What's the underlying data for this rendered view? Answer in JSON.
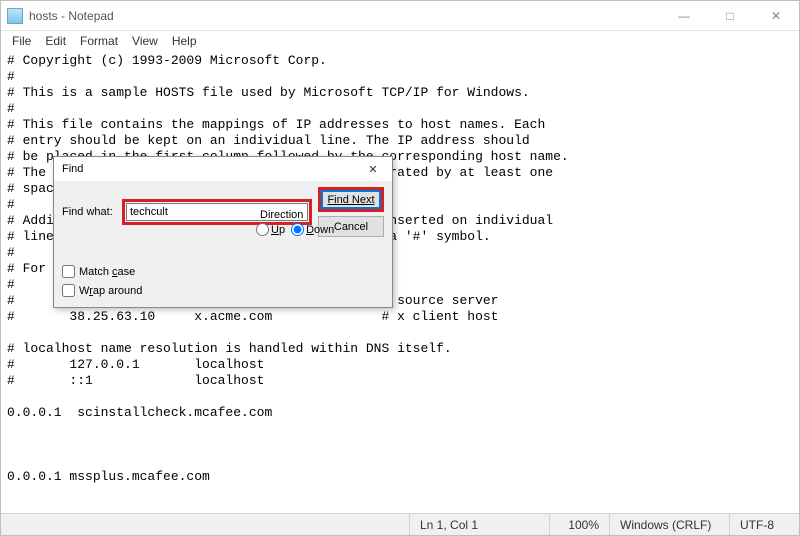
{
  "window": {
    "title": "hosts - Notepad",
    "minimize": "—",
    "maximize": "□",
    "close": "✕"
  },
  "menu": {
    "file": "File",
    "edit": "Edit",
    "format": "Format",
    "view": "View",
    "help": "Help"
  },
  "document_text": "# Copyright (c) 1993-2009 Microsoft Corp.\n#\n# This is a sample HOSTS file used by Microsoft TCP/IP for Windows.\n#\n# This file contains the mappings of IP addresses to host names. Each\n# entry should be kept on an individual line. The IP address should\n# be placed in the first column followed by the corresponding host name.\n# The IP address and the host name should be separated by at least one\n# space.\n#\n# Additionally, comments (such as these) may be inserted on individual\n# lines or following the machine name denoted by a '#' symbol.\n#\n# For example:\n#\n#      102.54.94.97     rhino.acme.com          # source server\n#       38.25.63.10     x.acme.com              # x client host\n\n# localhost name resolution is handled within DNS itself.\n#       127.0.0.1       localhost\n#       ::1             localhost\n\n0.0.0.1  scinstallcheck.mcafee.com\n\n\n\n0.0.0.1 mssplus.mcafee.com",
  "find_dialog": {
    "title": "Find",
    "close": "✕",
    "find_what_label": "Find what:",
    "find_what_value": "techcult",
    "find_next": "Find Next",
    "cancel": "Cancel",
    "direction_label": "Direction",
    "up": "Up",
    "down": "Down",
    "direction_selected": "down",
    "match_case": "Match case",
    "match_case_checked": false,
    "wrap_around": "Wrap around",
    "wrap_around_checked": false
  },
  "status": {
    "position": "Ln 1, Col 1",
    "zoom": "100%",
    "eol": "Windows (CRLF)",
    "encoding": "UTF-8"
  }
}
